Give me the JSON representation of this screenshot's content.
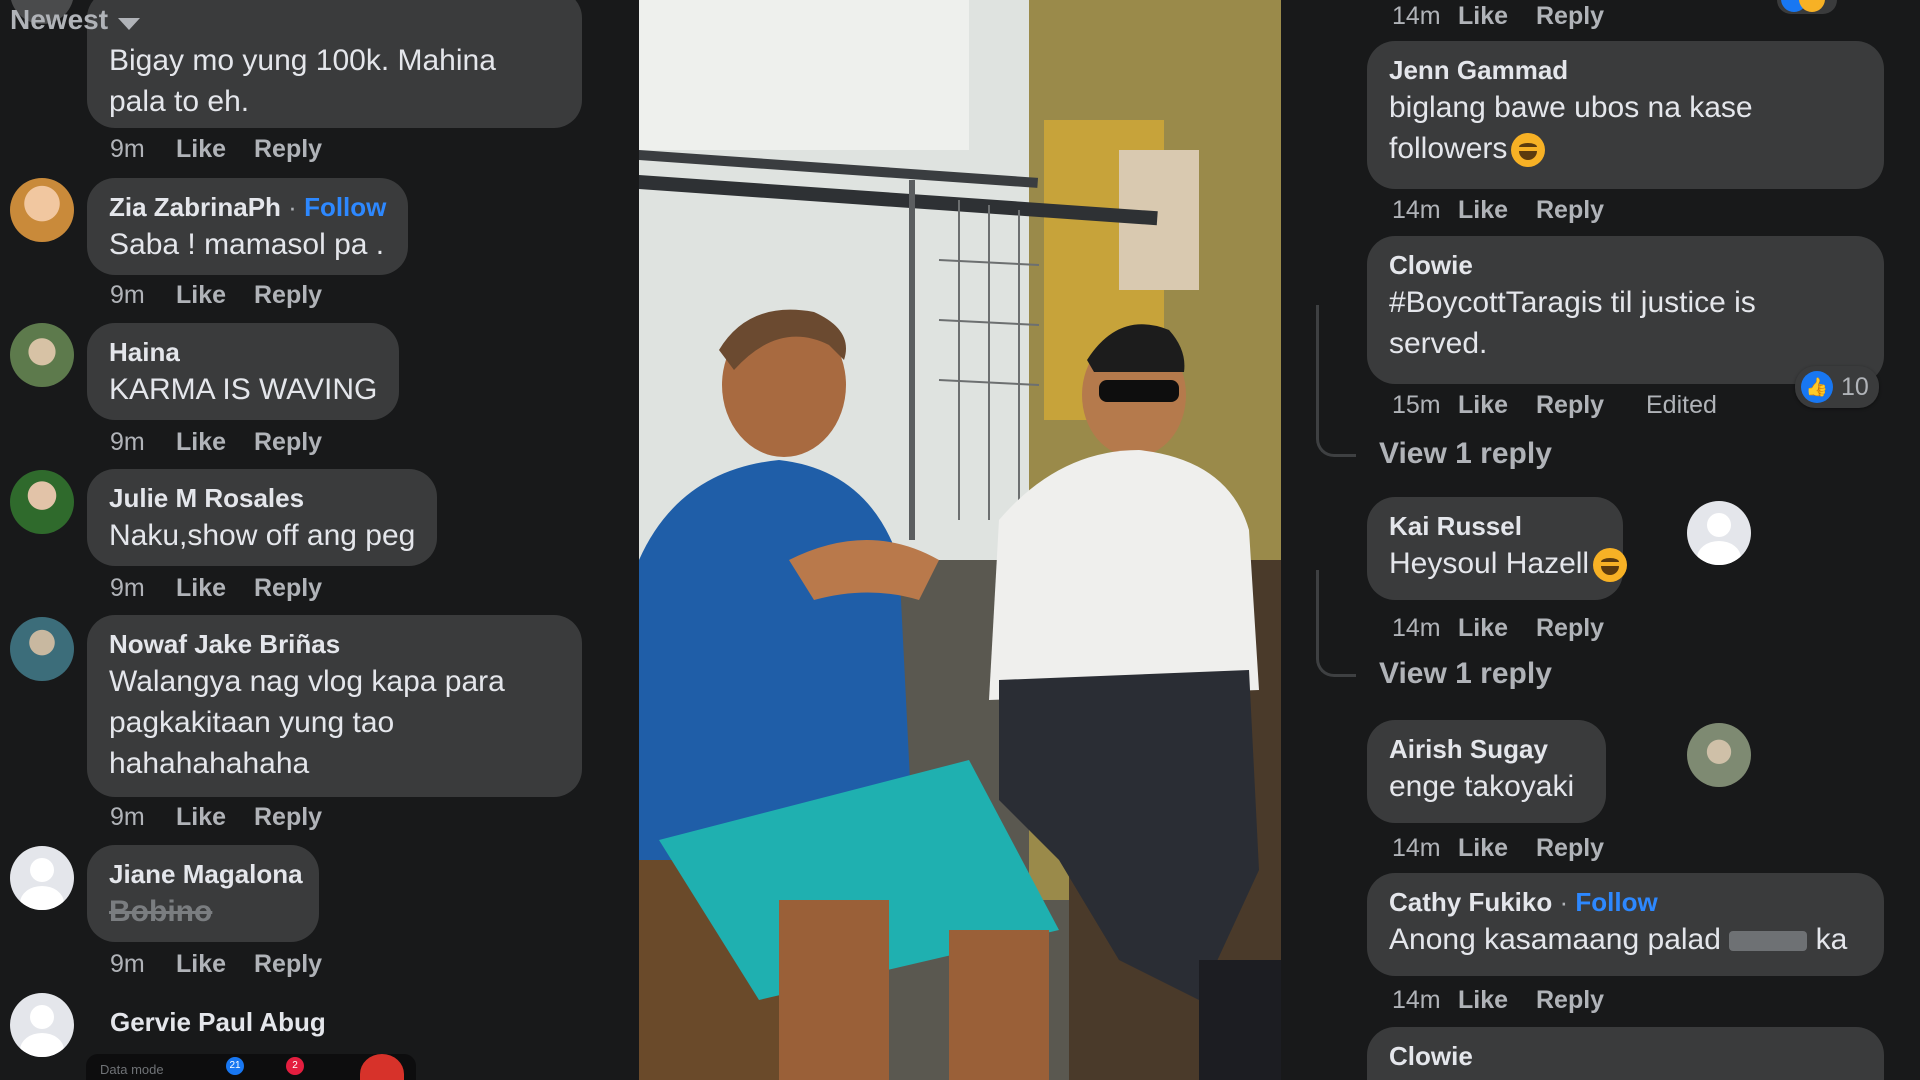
{
  "sort": {
    "label": "Newest"
  },
  "left_comments": [
    {
      "name": "",
      "text": "Bigay mo yung 100k. Mahina pala to eh.",
      "time": "9m"
    },
    {
      "name": "Zia ZabrinaPh",
      "follow": "Follow",
      "text": "Saba ! mamasol pa .",
      "time": "9m"
    },
    {
      "name": "Haina",
      "text": "KARMA IS WAVING",
      "time": "9m"
    },
    {
      "name": "Julie M Rosales",
      "text": "Naku,show off ang peg",
      "time": "9m"
    },
    {
      "name": "Nowaf Jake Briñas",
      "text": "Walangya nag vlog kapa para pagkakitaan yung tao hahahahahaha",
      "time": "9m"
    },
    {
      "name": "Jiane Magalona",
      "text": "Bobino",
      "time": "9m"
    },
    {
      "name": "Gervie Paul Abug",
      "text": ""
    }
  ],
  "right_comments": [
    {
      "time": "14m"
    },
    {
      "name": "Jenn Gammad",
      "text": "biglang bawe ubos na kase followers",
      "time": "14m"
    },
    {
      "name": "Clowie",
      "text": "#BoycottTaragis til justice is served.",
      "time": "15m",
      "edited": "Edited",
      "reactions": "10",
      "view_reply": "View 1 reply"
    },
    {
      "name": "Kai Russel",
      "text": "Heysoul Hazell",
      "time": "14m",
      "view_reply": "View 1 reply"
    },
    {
      "name": "Airish Sugay",
      "text": "enge takoyaki",
      "time": "14m"
    },
    {
      "name": "Cathy Fukiko",
      "follow": "Follow",
      "text": "Anong kasamaang palad",
      "text_end": "ka",
      "time": "14m"
    },
    {
      "name": "Clowie"
    }
  ],
  "actions": {
    "like": "Like",
    "reply": "Reply",
    "dot": "·"
  },
  "strip": {
    "label": "Data mode",
    "badge1": "21",
    "badge2": "2"
  },
  "colors": {
    "background": "#18191a",
    "bubble": "#3a3b3c",
    "text": "#e4e6eb",
    "secondary": "#b0b3b8",
    "link": "#2d88ff"
  }
}
